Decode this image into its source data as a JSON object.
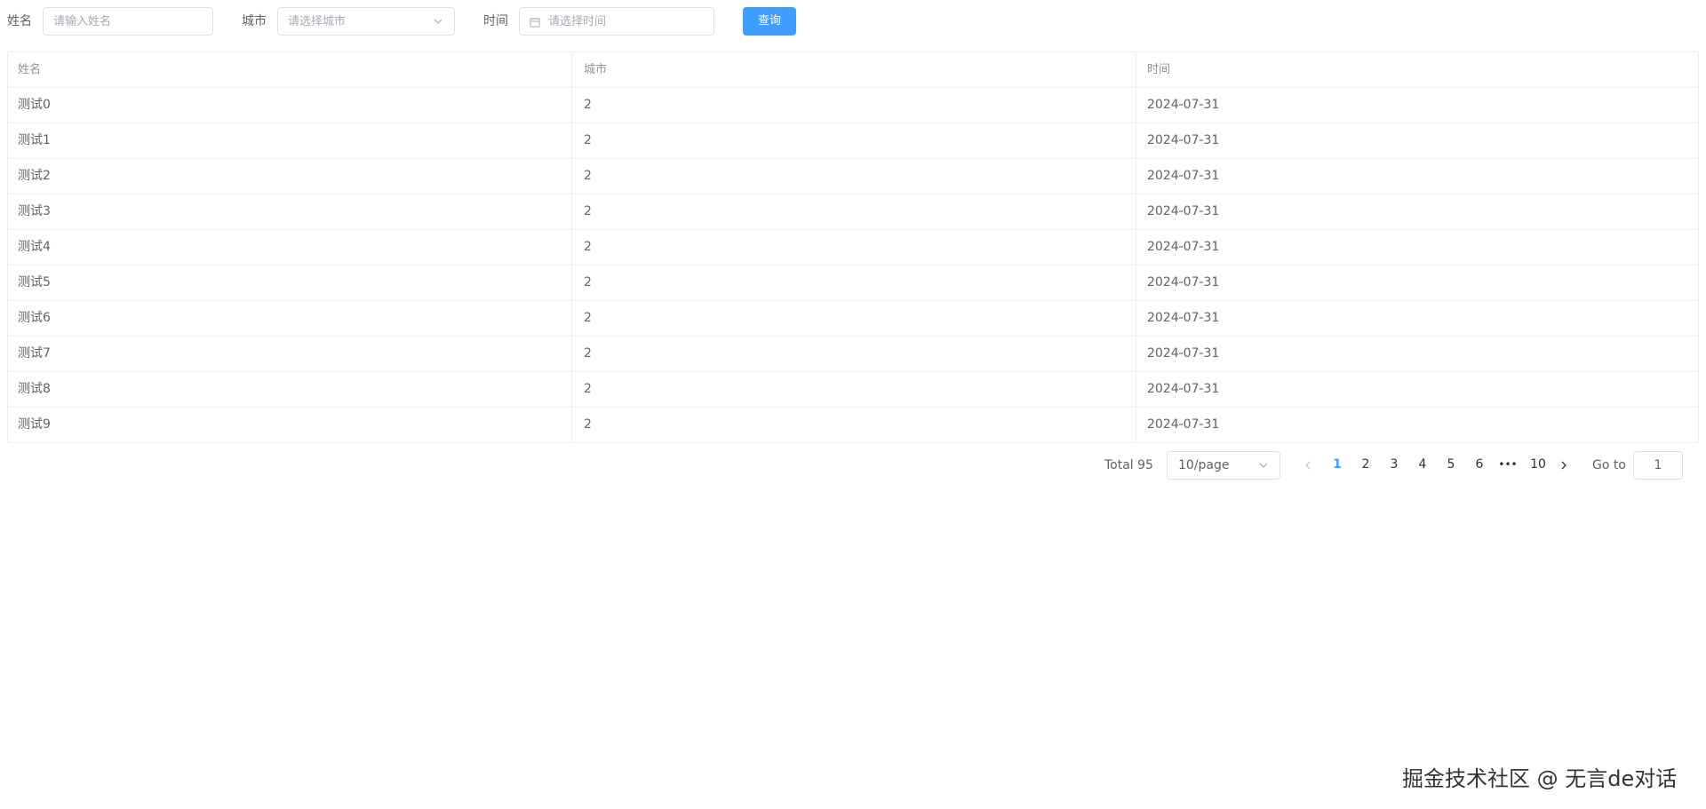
{
  "search": {
    "name_label": "姓名",
    "name_placeholder": "请输入姓名",
    "city_label": "城市",
    "city_placeholder": "请选择城市",
    "time_label": "时间",
    "time_placeholder": "请选择时间",
    "query_button": "查询",
    "icons": {
      "city_select": "chevron-down-icon",
      "time_picker": "calendar-icon"
    }
  },
  "table": {
    "columns": [
      "姓名",
      "城市",
      "时间"
    ],
    "rows": [
      [
        "测试0",
        "2",
        "2024-07-31"
      ],
      [
        "测试1",
        "2",
        "2024-07-31"
      ],
      [
        "测试2",
        "2",
        "2024-07-31"
      ],
      [
        "测试3",
        "2",
        "2024-07-31"
      ],
      [
        "测试4",
        "2",
        "2024-07-31"
      ],
      [
        "测试5",
        "2",
        "2024-07-31"
      ],
      [
        "测试6",
        "2",
        "2024-07-31"
      ],
      [
        "测试7",
        "2",
        "2024-07-31"
      ],
      [
        "测试8",
        "2",
        "2024-07-31"
      ],
      [
        "测试9",
        "2",
        "2024-07-31"
      ]
    ]
  },
  "pagination": {
    "total": "Total 95",
    "page_size": "10/page",
    "pages": [
      "1",
      "2",
      "3",
      "4",
      "5",
      "6",
      "•••",
      "10"
    ],
    "current_page": "1",
    "goto_label": "Go to",
    "goto_value": "1"
  },
  "watermark": "掘金技术社区 @ 无言de对话",
  "colors": {
    "primary": "#409eff",
    "border": "#dcdfe6",
    "table_border": "#ebeef5",
    "text": "#606266",
    "placeholder": "#a8abb2",
    "header_text": "#909399"
  }
}
